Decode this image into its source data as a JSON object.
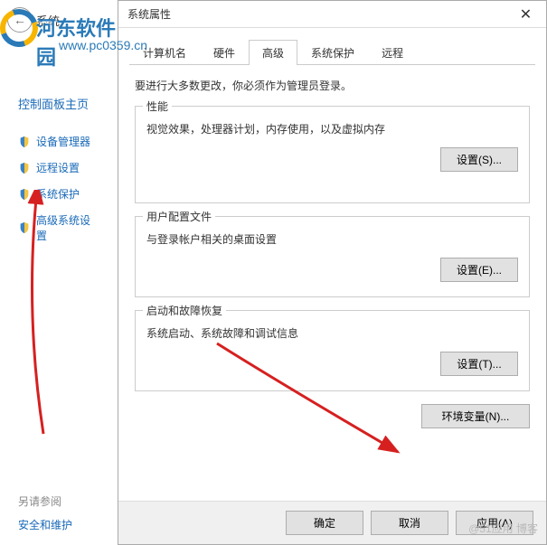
{
  "leftPane": {
    "systemLabel": "系统",
    "cpHome": "控制面板主页",
    "links": [
      "设备管理器",
      "远程设置",
      "系统保护",
      "高级系统设置"
    ],
    "seeAlso": "另请参阅",
    "seeAlsoLink": "安全和维护"
  },
  "dialog": {
    "title": "系统属性",
    "tabs": [
      "计算机名",
      "硬件",
      "高级",
      "系统保护",
      "远程"
    ],
    "activeTab": 2,
    "intro": "要进行大多数更改，你必须作为管理员登录。",
    "perf": {
      "title": "性能",
      "desc": "视觉效果，处理器计划，内存使用，以及虚拟内存",
      "btn": "设置(S)..."
    },
    "user": {
      "title": "用户配置文件",
      "desc": "与登录帐户相关的桌面设置",
      "btn": "设置(E)..."
    },
    "startup": {
      "title": "启动和故障恢复",
      "desc": "系统启动、系统故障和调试信息",
      "btn": "设置(T)..."
    },
    "envBtn": "环境变量(N)...",
    "footer": {
      "ok": "确定",
      "cancel": "取消",
      "apply": "应用(A)"
    }
  },
  "watermark": {
    "brand": "河东软件园",
    "url": "www.pc0359.cn",
    "bottom": "@51应用 博客"
  }
}
